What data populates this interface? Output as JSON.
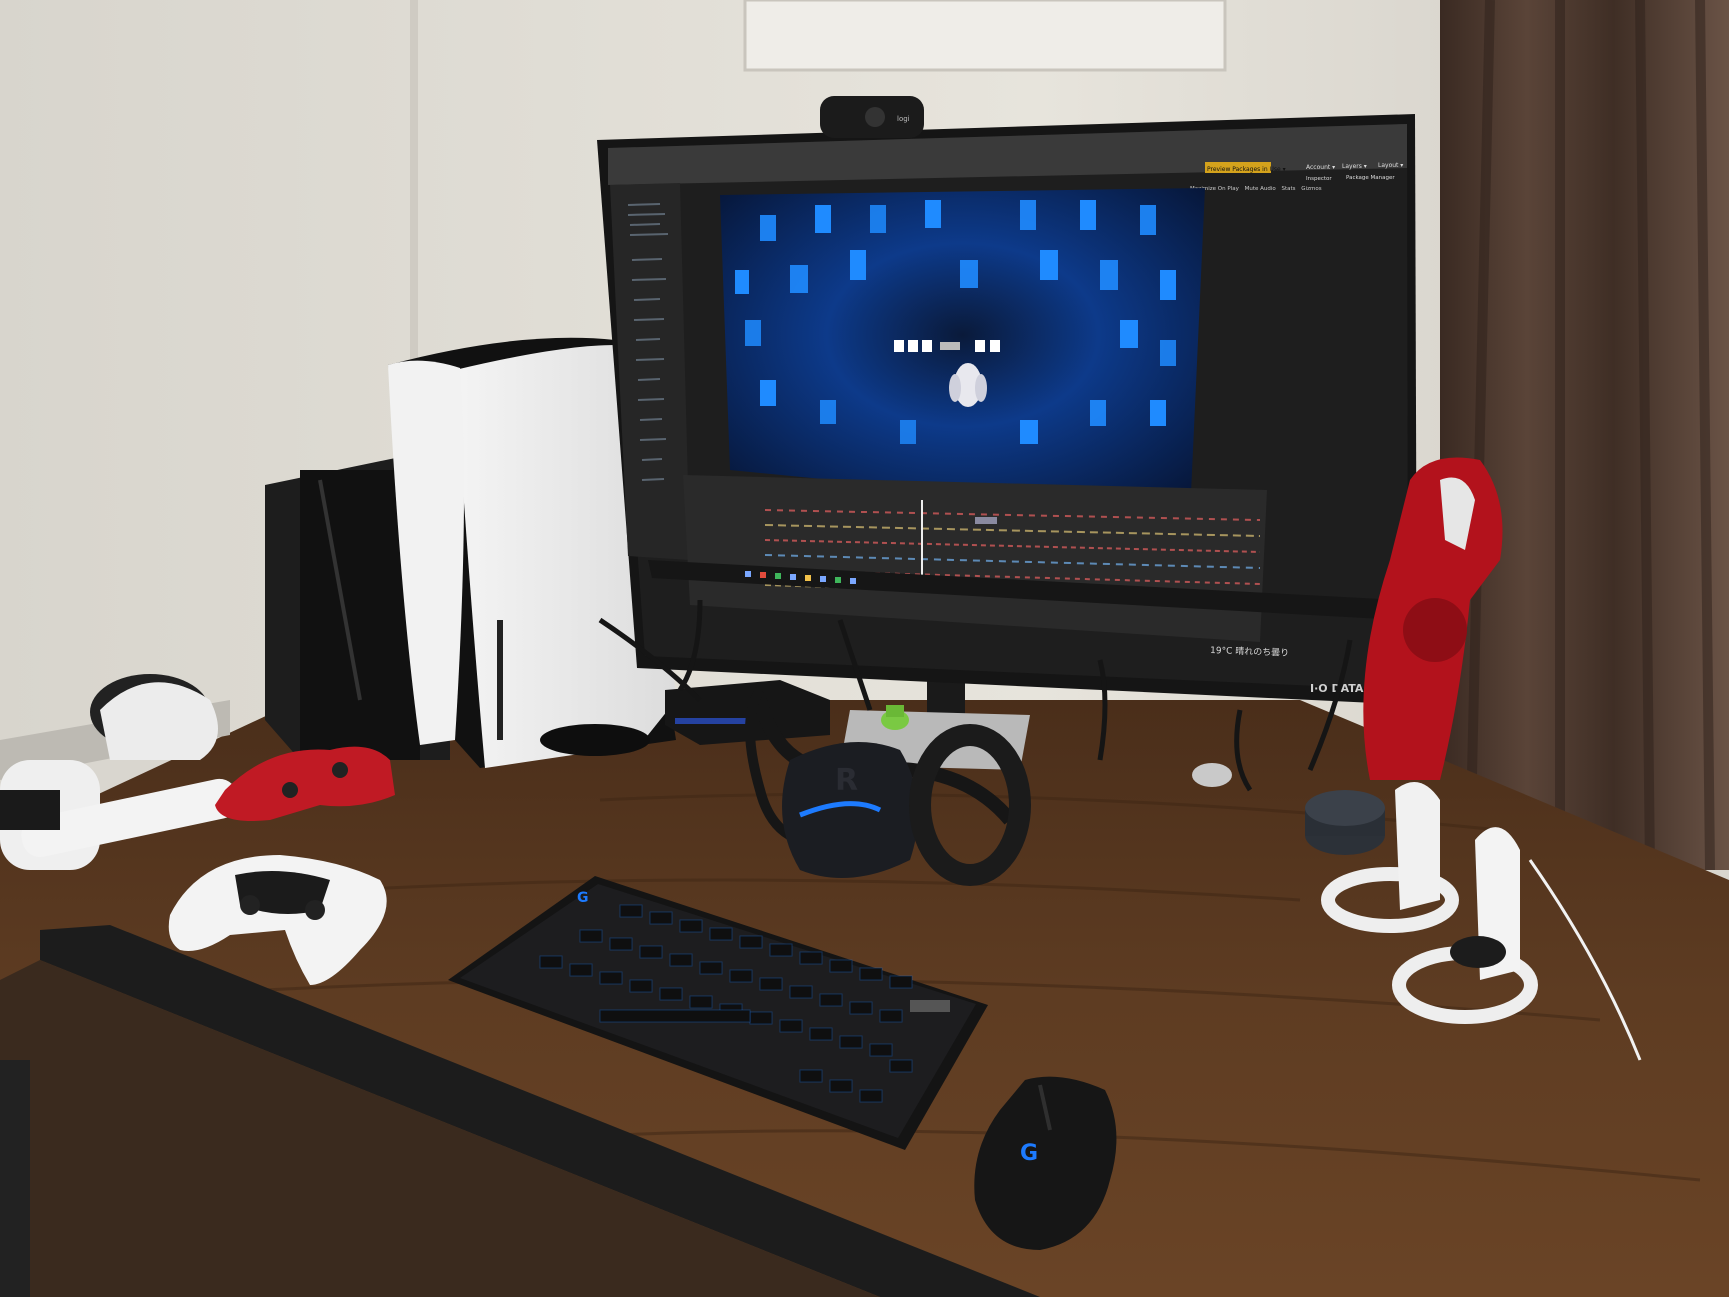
{
  "monitor": {
    "brand": "I·O DATA",
    "webcam_brand": "logi",
    "editor": {
      "package_button": "Preview Packages in Use ▾",
      "account": "Account ▾",
      "layers": "Layers ▾",
      "layout": "Layout ▾",
      "inspector_tab": "Inspector",
      "package_manager_tab": "Package Manager",
      "game_view_options": [
        "Maximize On Play",
        "Mute Audio",
        "Stats",
        "Gizmos"
      ]
    },
    "taskbar": {
      "weather": "19°C 晴れのち曇り"
    }
  },
  "keyboard": {
    "logo": "G"
  },
  "mouse": {
    "logo": "G"
  },
  "headset": {
    "logo": "R"
  },
  "colors": {
    "wall": "#e3e0d8",
    "desk": "#5a3a22",
    "screen_blue": "#1f8bff",
    "editor_dark": "#2b2b2b",
    "vacuum_red": "#b3121c"
  }
}
